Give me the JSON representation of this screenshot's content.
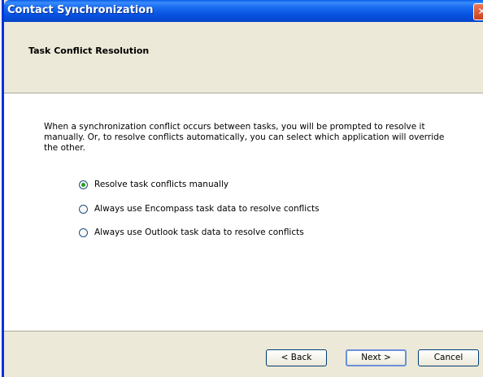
{
  "window": {
    "title": "Contact Synchronization"
  },
  "header": {
    "title": "Task Conflict Resolution"
  },
  "content": {
    "description": "When a synchronization conflict occurs between tasks, you will be prompted to resolve it manually. Or, to resolve conflicts automatically, you can select which application will override the other.",
    "options": [
      {
        "label": "Resolve task conflicts manually",
        "checked": true
      },
      {
        "label": "Always use Encompass task data to resolve conflicts",
        "checked": false
      },
      {
        "label": "Always use Outlook task data to resolve conflicts",
        "checked": false
      }
    ]
  },
  "buttons": {
    "back": "< Back",
    "next": "Next >",
    "cancel": "Cancel"
  }
}
